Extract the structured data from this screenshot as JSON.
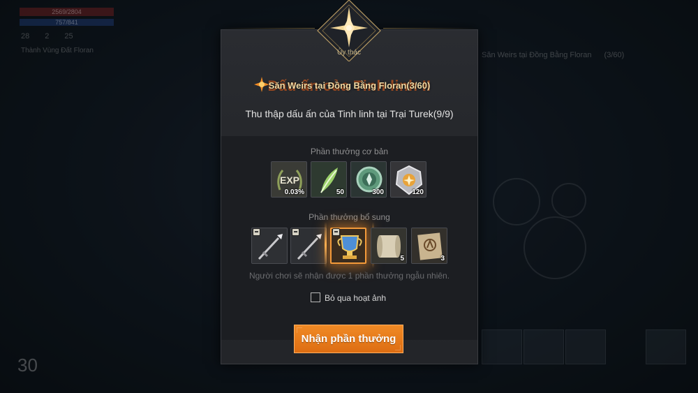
{
  "background_hud": {
    "hp": "2569/2804",
    "mp": "757/841",
    "stats": [
      "28",
      "2",
      "25"
    ],
    "region_label": "Thành",
    "region_name": "Vùng Đất Floran",
    "quest_lines": [
      {
        "name": "Săn Weirs tại Đồng Bằng Floran",
        "progress": "(3/60)"
      }
    ],
    "level": "30"
  },
  "dialog": {
    "emblem_label": "Ủy thác",
    "title_ghost": "Dấu ấn của Tinh linh II",
    "title": "Săn Weirs tại Đồng Bằng Floran(3/60)",
    "subtitle": "Thu thập dấu ấn của Tinh linh tại Trại Turek(9/9)",
    "basic_rewards_label": "Phần thưởng cơ bản",
    "basic_rewards": [
      {
        "icon": "exp-laurel-icon",
        "qty": "0.03%"
      },
      {
        "icon": "green-herb-icon",
        "qty": "50"
      },
      {
        "icon": "green-coin-icon",
        "qty": "300"
      },
      {
        "icon": "silver-medal-icon",
        "qty": "120"
      }
    ],
    "bonus_rewards_label": "Phần thưởng bổ sung",
    "bonus_rewards": [
      {
        "icon": "spear-icon",
        "qty": ""
      },
      {
        "icon": "spear-icon",
        "qty": ""
      },
      {
        "icon": "blue-trophy-icon",
        "qty": ""
      },
      {
        "icon": "scroll-icon",
        "qty": "5"
      },
      {
        "icon": "parchment-icon",
        "qty": "3"
      }
    ],
    "random_note": "Người chơi sẽ nhận được 1 phần thưởng ngẫu nhiên.",
    "skip_animation_label": "Bỏ qua hoạt ảnh",
    "claim_button": "Nhận phần thưởng"
  },
  "colors": {
    "accent": "#e67a1c",
    "title_gold": "#f1d9a3",
    "panel": "#26282c"
  }
}
